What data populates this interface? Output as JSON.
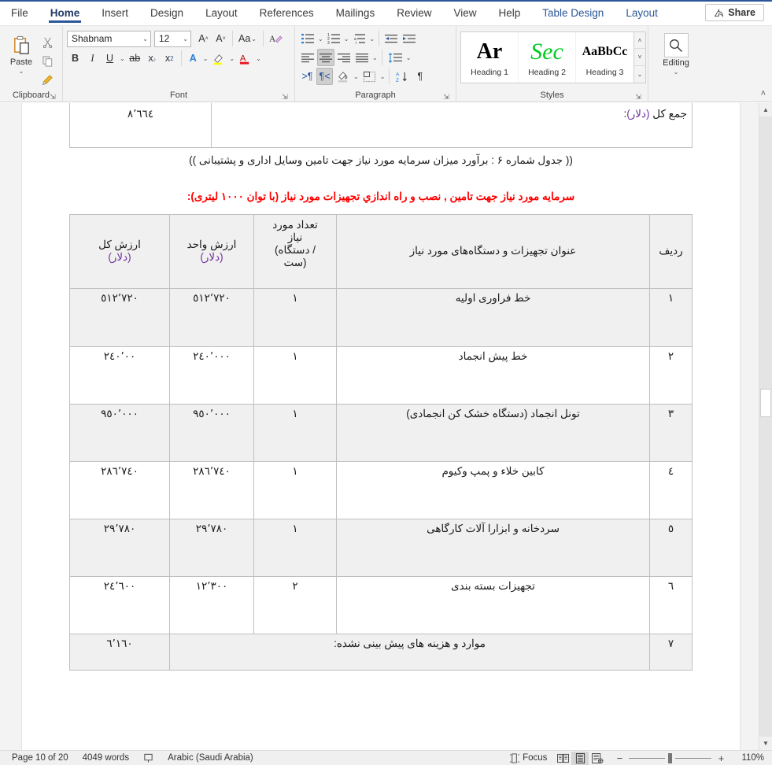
{
  "app": {
    "tabs": [
      {
        "label": "File",
        "state": "normal"
      },
      {
        "label": "Home",
        "state": "active"
      },
      {
        "label": "Insert",
        "state": "normal"
      },
      {
        "label": "Design",
        "state": "normal"
      },
      {
        "label": "Layout",
        "state": "normal"
      },
      {
        "label": "References",
        "state": "normal"
      },
      {
        "label": "Mailings",
        "state": "normal"
      },
      {
        "label": "Review",
        "state": "normal"
      },
      {
        "label": "View",
        "state": "normal"
      },
      {
        "label": "Help",
        "state": "normal"
      },
      {
        "label": "Table Design",
        "state": "contextual"
      },
      {
        "label": "Layout",
        "state": "contextual"
      }
    ],
    "share_label": "Share",
    "accent_color": "#2b579a",
    "contextual_color": "#2b579a"
  },
  "ribbon": {
    "groups": [
      {
        "name": "Clipboard",
        "label": "Clipboard",
        "paste_label": "Paste"
      },
      {
        "name": "Font",
        "label": "Font"
      },
      {
        "name": "Paragraph",
        "label": "Paragraph"
      },
      {
        "name": "Styles",
        "label": "Styles"
      },
      {
        "name": "Editing",
        "label": "Editing"
      }
    ],
    "font": {
      "family_value": "Shabnam",
      "size_value": "12"
    },
    "styles": [
      {
        "name": "Heading 1",
        "preview": "Ar",
        "color": "#000000"
      },
      {
        "name": "Heading 2",
        "preview": "Sec",
        "color": "#00b050"
      },
      {
        "name": "Heading 3",
        "preview": "AaBbCc",
        "color": "#000000"
      }
    ],
    "editing_label": "Editing"
  },
  "document": {
    "top_table": {
      "total_label": "جمع کل (دلار):",
      "total_label_plain": "جمع کل ",
      "total_label_currency": "(دلار)",
      "total_label_colon": ":",
      "total_value": "٨٬٦٦٤"
    },
    "caption": "(( جدول شماره ۶ : برآورد میزان سرمایه مورد نیاز جهت تامین وسایل اداری و پشتیبانی ))",
    "red_heading": "سرمایه مورد نیاز جهت تامین , نصب و راه اندازي تجهیزات مورد نیاز (با توان ۱۰۰۰ لیتری):",
    "main_table": {
      "headers": {
        "row_no": "ردیف",
        "title": "عنوان تجهیزات و دستگاه‌های مورد نیاز",
        "qty": "تعداد مورد نیاز (دستگاه / ست)",
        "qty_l1": "تعداد مورد",
        "qty_l2": "نیاز",
        "qty_l3": "(دستگاه /",
        "qty_l4": "ست)",
        "unit_value_l1": "ارزش واحد",
        "unit_value_l2": "(دلار)",
        "total_value_l1": "ارزش کل",
        "total_value_l2": "(دلار)"
      },
      "rows": [
        {
          "no": "١",
          "title": "خط فراوری اولیه",
          "qty": "١",
          "unit": "٥١٢٬٧٢٠",
          "total": "٥١٢٬٧٢٠",
          "shaded": true
        },
        {
          "no": "٢",
          "title": "خط پیش انجماد",
          "qty": "١",
          "unit": "٢٤٠٬٠٠٠",
          "total": "٢٤٠٬٠٠",
          "shaded": false
        },
        {
          "no": "٣",
          "title": "تونل انجماد (دستگاه خشک کن انجمادی)",
          "qty": "١",
          "unit": "٩٥٠٬٠٠٠",
          "total": "٩٥٠٬٠٠٠",
          "shaded": true
        },
        {
          "no": "٤",
          "title": "کابین خلاء و پمپ وکیوم",
          "qty": "١",
          "unit": "٢٨٦٬٧٤٠",
          "total": "٢٨٦٬٧٤٠",
          "shaded": false
        },
        {
          "no": "٥",
          "title": "سردخانه و ابزارا آلات کارگاهی",
          "qty": "١",
          "unit": "٢٩٬٧٨٠",
          "total": "٢٩٬٧٨٠",
          "shaded": true
        },
        {
          "no": "٦",
          "title": "تجهیزات بسته بندی",
          "qty": "٢",
          "unit": "١٢٬٣٠٠",
          "total": "٢٤٬٦٠٠",
          "shaded": false
        },
        {
          "no": "٧",
          "title": "موارد و هزینه های پیش بینی نشده:",
          "qty": "",
          "unit": "",
          "total": "٦٬١٦٠",
          "shaded": true,
          "merged": true
        }
      ]
    }
  },
  "status": {
    "page": "Page 10 of 20",
    "words": "4049 words",
    "language": "Arabic (Saudi Arabia)",
    "focus": "Focus",
    "zoom": "110%",
    "zoom_minus": "−",
    "zoom_plus": "+"
  }
}
